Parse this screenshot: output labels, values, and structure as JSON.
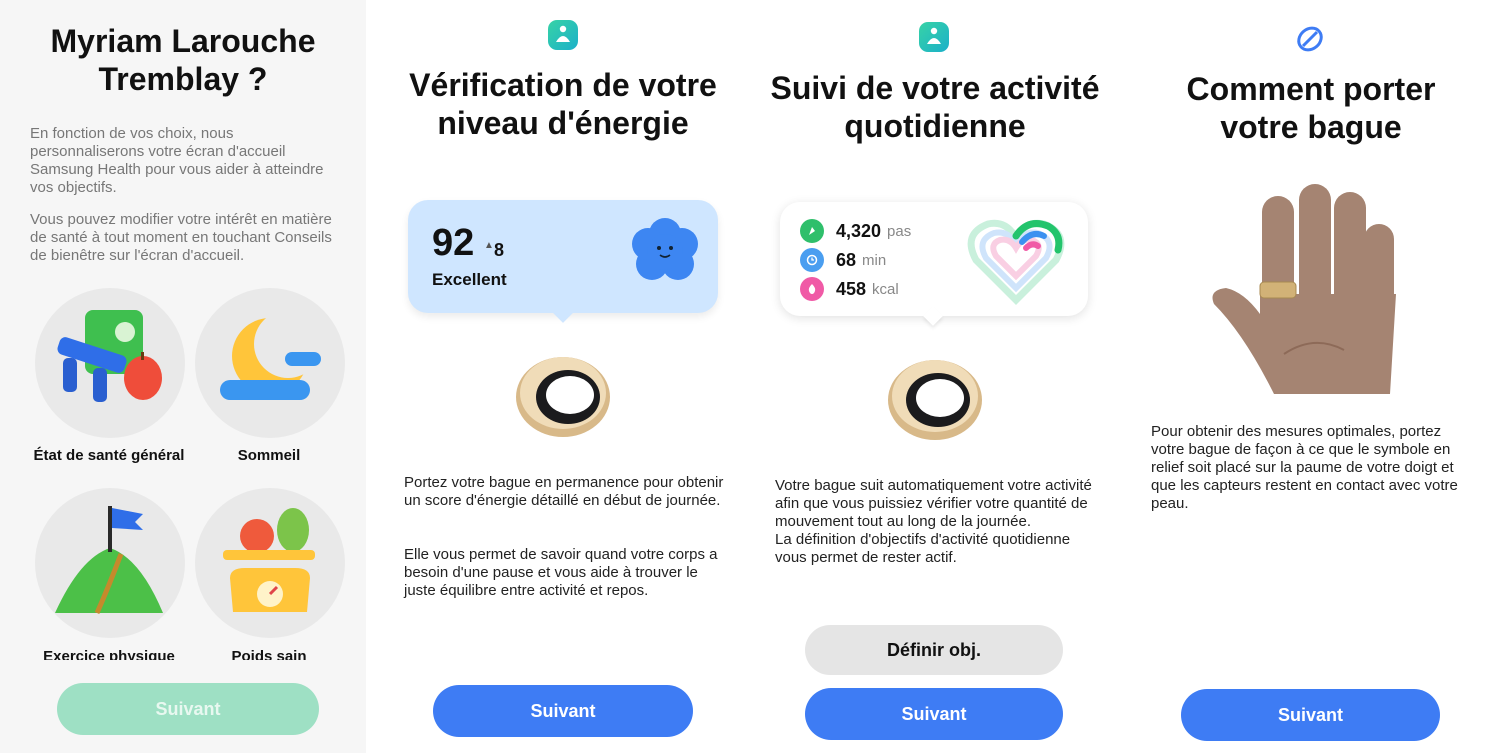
{
  "panel1": {
    "title_line1": "Myriam Larouche",
    "title_line2": "Tremblay ?",
    "para1": "En fonction de vos choix, nous personnaliserons votre écran d'accueil Samsung Health pour vous aider à atteindre vos objectifs.",
    "para2": "Vous pouvez modifier votre intérêt en matière de santé à tout moment en touchant Conseils de bienêtre sur l'écran d'accueil.",
    "categories": [
      {
        "label": "État de santé général"
      },
      {
        "label": "Sommeil"
      },
      {
        "label": "Exercice physique"
      },
      {
        "label": "Poids sain"
      }
    ],
    "next_label": "Suivant"
  },
  "panel2": {
    "title_line1": "Vérification de votre",
    "title_line2": "niveau d'énergie",
    "score": "92",
    "delta": "8",
    "rating": "Excellent",
    "para1": "Portez votre bague en permanence pour obtenir un score d'énergie détaillé en début de journée.",
    "para2": "Elle vous permet de savoir quand votre corps a besoin d'une pause et vous aide à trouver le juste équilibre entre activité et repos.",
    "next_label": "Suivant"
  },
  "panel3": {
    "title_line1": "Suivi de votre activité",
    "title_line2": "quotidienne",
    "stats": [
      {
        "value": "4,320",
        "unit": "pas",
        "color": "#2fbf6b"
      },
      {
        "value": "68",
        "unit": "min",
        "color": "#4a9ef0"
      },
      {
        "value": "458",
        "unit": "kcal",
        "color": "#f05aa6"
      }
    ],
    "para": "Votre bague suit automatiquement votre activité afin que vous puissiez vérifier votre quantité de mouvement tout au long de la journée.\nLa définition d'objectifs d'activité quotidienne vous permet de rester actif.",
    "goal_label": "Définir obj.",
    "next_label": "Suivant"
  },
  "panel4": {
    "title_line1": "Comment porter",
    "title_line2": "votre bague",
    "para": "Pour obtenir des mesures optimales, portez votre bague de façon à ce que le symbole en relief soit placé sur la paume de votre doigt et que les capteurs restent en contact avec votre peau.",
    "next_label": "Suivant"
  },
  "colors": {
    "primary": "#3e7cf4",
    "primary_disabled": "#9ee0c4",
    "energy_card": "#cfe6ff",
    "app_icon": "#1fc0b4"
  }
}
